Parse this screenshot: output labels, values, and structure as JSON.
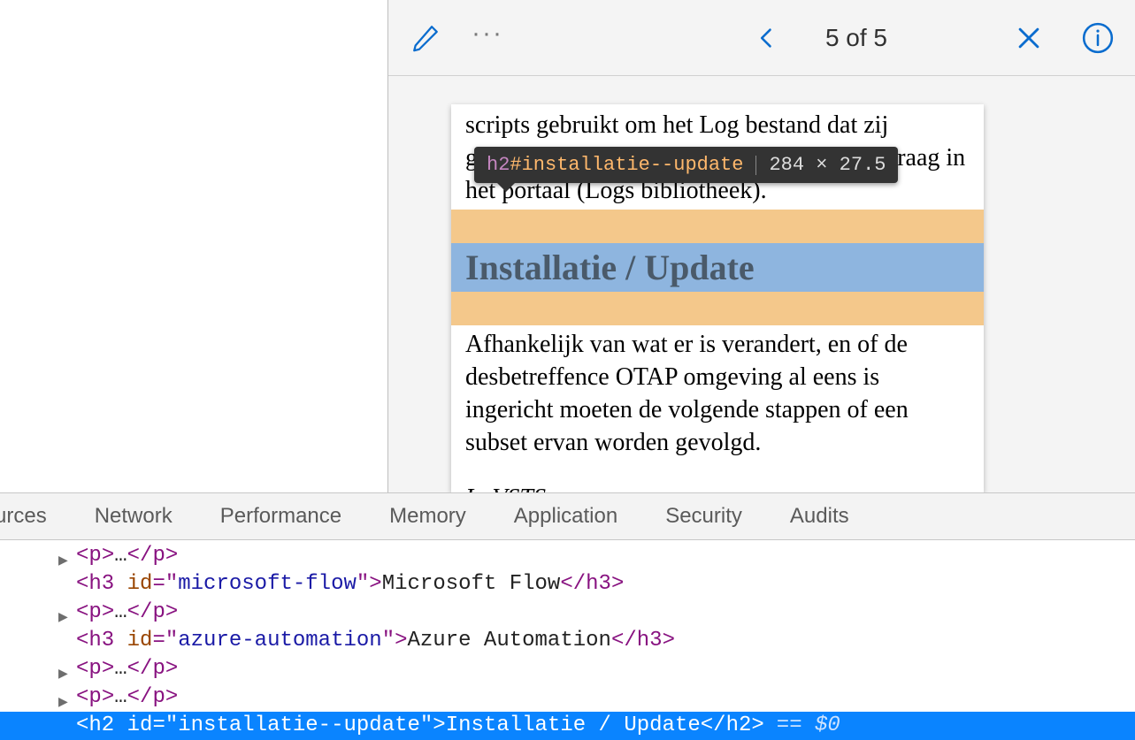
{
  "toolbar": {
    "page_counter": "5 of 5"
  },
  "tooltip": {
    "tag": "h2",
    "id": "#installatie--update",
    "dimensions": "284 × 27.5"
  },
  "document": {
    "para1": "scripts gebruikt om het Log bestand dat zij genereren op te slaan in een folder per aanvraag in het portaal (Logs bibliotheek).",
    "heading": "Installatie / Update",
    "para2": "Afhankelijk van wat er is verandert, en of de desbetreffence OTAP omgeving al eens is ingericht moeten de volgende stappen of een subset ervan worden gevolgd.",
    "para3_prefix": "In ",
    "para3_em": "VSTS"
  },
  "devtools": {
    "tabs": {
      "sources": "urces",
      "network": "Network",
      "performance": "Performance",
      "memory": "Memory",
      "application": "Application",
      "security": "Security",
      "audits": "Audits"
    },
    "rows": {
      "p_collapsed": "<p>…</p>",
      "h3_flow_open": "<h3 id=\"microsoft-flow\">",
      "h3_flow_text": "Microsoft Flow",
      "h3_close": "</h3>",
      "h3_auto_open": "<h3 id=\"azure-automation\">",
      "h3_auto_text": "Azure Automation",
      "h2_sel_open": "<h2 id=\"installatie--update\">",
      "h2_sel_text": "Installatie / Update",
      "h2_close": "</h2>",
      "eq0": "== $0"
    }
  }
}
